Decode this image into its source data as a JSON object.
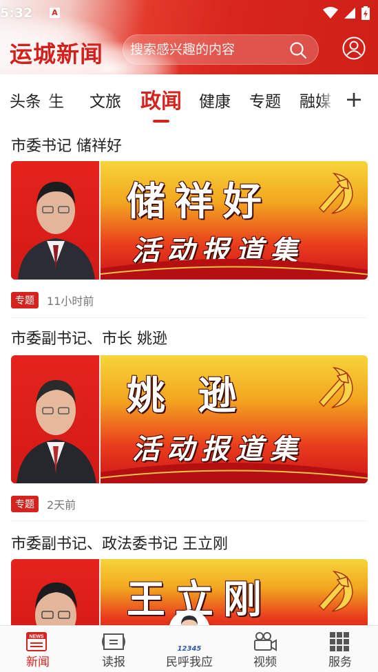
{
  "status_bar": {
    "time": "5:32",
    "a_badge": "A"
  },
  "header": {
    "logo": "运城新闻",
    "search_placeholder": "搜索感兴趣的内容"
  },
  "tabs": {
    "items": [
      "头条",
      "民生",
      "文旅",
      "政闻",
      "健康",
      "专题",
      "融媒"
    ],
    "partial_left": "头条",
    "partial_second": "生",
    "active": "政闻",
    "more": "+"
  },
  "articles": [
    {
      "title": "市委书记 储祥好",
      "banner_name": "储祥好",
      "banner_sub": "活动报道集",
      "badge": "专题",
      "time": "11小时前"
    },
    {
      "title": "市委副书记、市长 姚逊",
      "banner_name": "姚  逊",
      "banner_sub": "活动报道集",
      "badge": "专题",
      "time": "2天前"
    },
    {
      "title": "市委副书记、政法委书记 王立刚",
      "banner_name": "王立刚",
      "banner_sub": "",
      "badge": "",
      "time": ""
    }
  ],
  "bottom_nav": {
    "news": "新闻",
    "read": "读报",
    "center": "民呼我应",
    "center_badge": "12345",
    "video": "视频",
    "service": "服务",
    "news_icon_text": "NEWS"
  },
  "colors": {
    "accent": "#d5231d",
    "header_red": "#d8261c"
  }
}
